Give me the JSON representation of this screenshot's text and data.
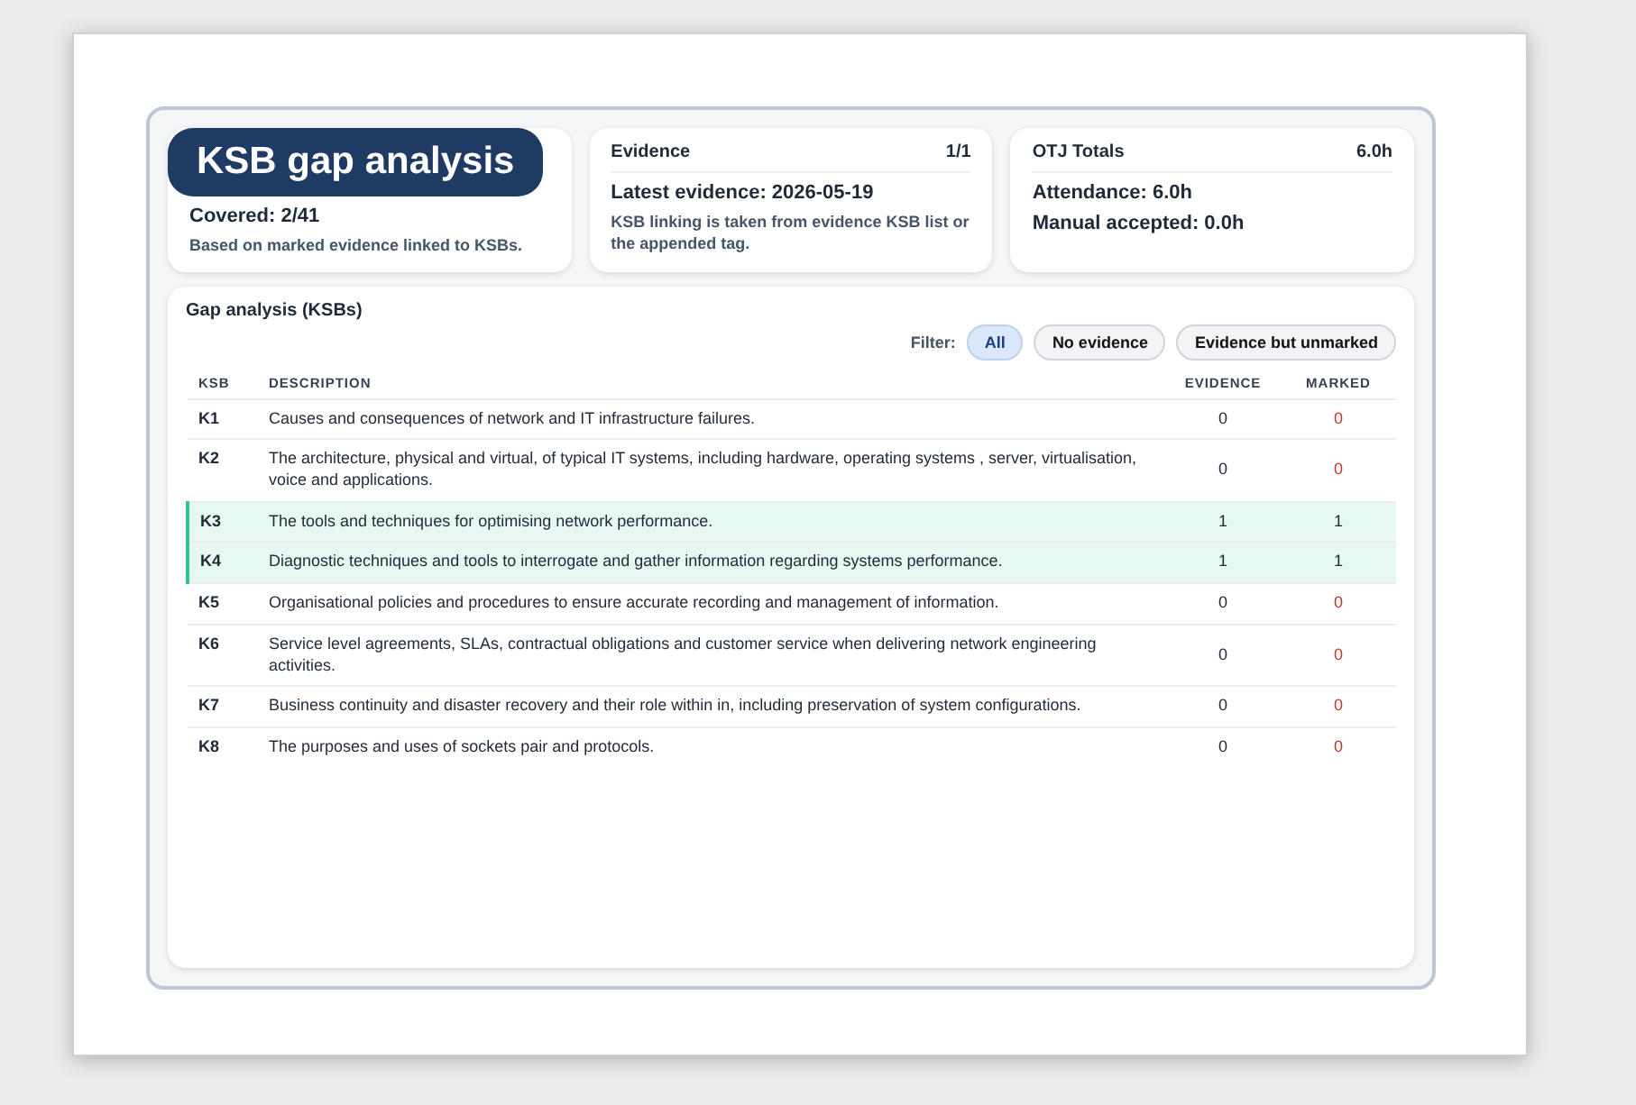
{
  "title": "KSB gap analysis",
  "coverage": {
    "covered": "Covered: 2/41",
    "note": "Based on marked evidence linked to KSBs."
  },
  "evidence": {
    "title": "Evidence",
    "count": "1/1",
    "latest": "Latest evidence: 2026-05-19",
    "note": "KSB linking is taken from evidence KSB list or the appended tag."
  },
  "otj": {
    "title": "OTJ Totals",
    "total": "6.0h",
    "lines": [
      "Attendance: 6.0h",
      "Manual accepted: 0.0h"
    ]
  },
  "gap": {
    "title": "Gap analysis (KSBs)",
    "filter_label": "Filter:",
    "filters": [
      {
        "label": "All",
        "selected": true
      },
      {
        "label": "No evidence",
        "selected": false
      },
      {
        "label": "Evidence but unmarked",
        "selected": false
      }
    ],
    "columns": [
      "KSB",
      "DESCRIPTION",
      "EVIDENCE",
      "MARKED"
    ],
    "rows": [
      {
        "ksb": "K1",
        "description": "Causes and consequences of network and IT infrastructure failures.",
        "evidence": "0",
        "marked": "0",
        "covered": false
      },
      {
        "ksb": "K2",
        "description": "The architecture, physical and virtual, of typical IT systems, including hardware, operating systems , server, virtualisation, voice and applications.",
        "evidence": "0",
        "marked": "0",
        "covered": false
      },
      {
        "ksb": "K3",
        "description": "The tools and techniques for optimising network performance.",
        "evidence": "1",
        "marked": "1",
        "covered": true
      },
      {
        "ksb": "K4",
        "description": "Diagnostic techniques and tools to interrogate and gather information regarding systems performance.",
        "evidence": "1",
        "marked": "1",
        "covered": true
      },
      {
        "ksb": "K5",
        "description": "Organisational policies and procedures to ensure accurate recording and management of information.",
        "evidence": "0",
        "marked": "0",
        "covered": false
      },
      {
        "ksb": "K6",
        "description": "Service level agreements, SLAs, contractual obligations and customer service when delivering network engineering activities.",
        "evidence": "0",
        "marked": "0",
        "covered": false
      },
      {
        "ksb": "K7",
        "description": "Business continuity and disaster recovery and their role within in, including preservation of system configurations.",
        "evidence": "0",
        "marked": "0",
        "covered": false
      },
      {
        "ksb": "K8",
        "description": "The purposes and uses of sockets pair and protocols.",
        "evidence": "0",
        "marked": "0",
        "covered": false
      }
    ]
  }
}
